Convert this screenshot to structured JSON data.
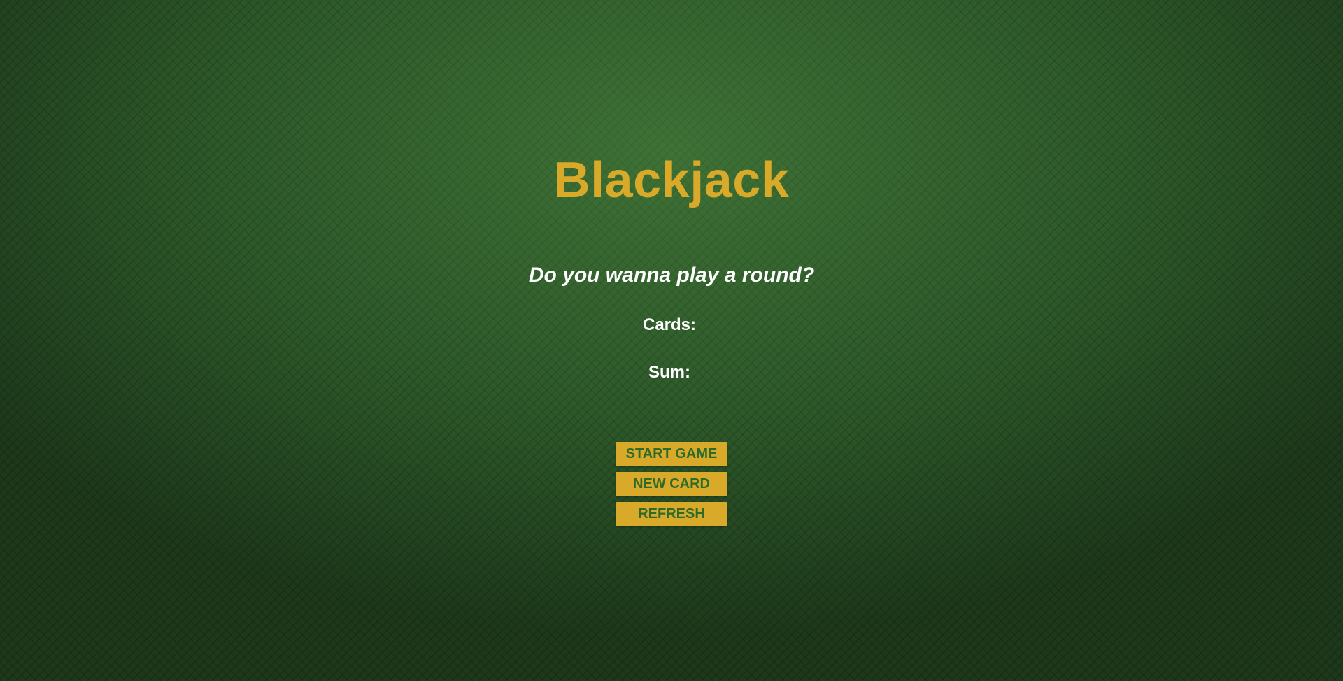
{
  "title": "Blackjack",
  "message": "Do you wanna play a round?",
  "cards": {
    "label": "Cards:",
    "value": ""
  },
  "sum": {
    "label": "Sum:",
    "value": ""
  },
  "buttons": {
    "start": "START GAME",
    "new_card": "NEW CARD",
    "refresh": "REFRESH"
  },
  "colors": {
    "felt": "#2e5a2a",
    "gold": "#d9a92a",
    "button_text": "#2e6b2a",
    "text": "#ffffff"
  }
}
